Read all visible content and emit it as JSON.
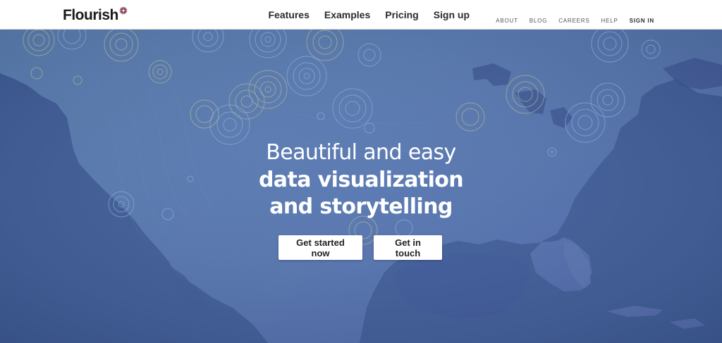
{
  "brand": {
    "name": "Flourish"
  },
  "main_nav": [
    {
      "label": "Features"
    },
    {
      "label": "Examples"
    },
    {
      "label": "Pricing"
    },
    {
      "label": "Sign up"
    }
  ],
  "sub_nav": [
    {
      "label": "ABOUT"
    },
    {
      "label": "BLOG"
    },
    {
      "label": "CAREERS"
    },
    {
      "label": "HELP"
    },
    {
      "label": "SIGN IN"
    }
  ],
  "hero": {
    "line1": "Beautiful and easy",
    "line2": "data visualization",
    "line3": "and storytelling",
    "primary_cta": "Get started now",
    "secondary_cta": "Get in touch"
  },
  "colors": {
    "hero_background": "#4160a2",
    "land": "#5a7fb6",
    "water": "#3c5995",
    "ring_blue": "#8fb6e8",
    "ring_yellow": "#c7c58d",
    "logo_mark": "#7a2b4c"
  },
  "icons": {
    "logo_mark": "starburst-icon"
  }
}
